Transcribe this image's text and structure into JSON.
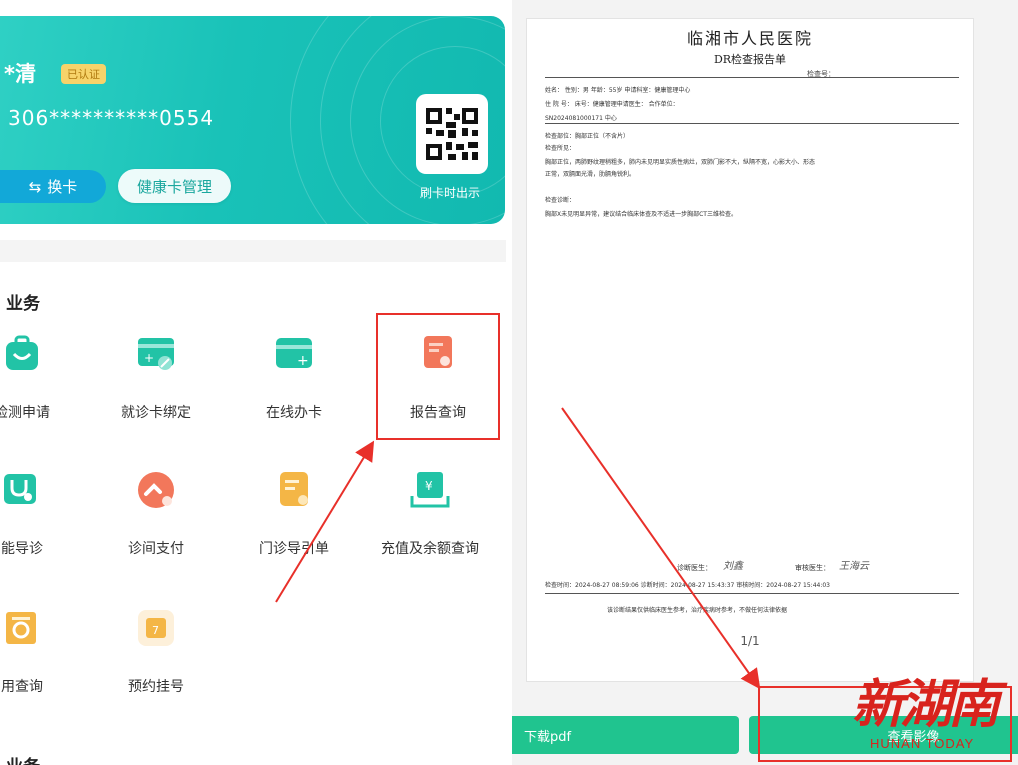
{
  "health_card": {
    "holder_name": "*清",
    "verified_badge": "已认证",
    "card_number": "306**********0554",
    "switch_card_label": "换卡",
    "switch_icon": "swap-arrows-icon",
    "manage_card_label": "健康卡管理",
    "qr_caption": "刷卡时出示",
    "qr_icon": "qr-code-icon"
  },
  "services": {
    "section_title": "业务",
    "section_title_2": "业务",
    "items": [
      {
        "label": "检测申请",
        "icon": "bag-icon",
        "color": "#22c3a6"
      },
      {
        "label": "就诊卡绑定",
        "icon": "card-link-icon",
        "color": "#22c3a6"
      },
      {
        "label": "在线办卡",
        "icon": "card-add-icon",
        "color": "#22c3a6"
      },
      {
        "label": "报告查询",
        "icon": "report-search-icon",
        "color": "#f2775b"
      },
      {
        "label": "能导诊",
        "icon": "stethoscope-icon",
        "color": "#22c3a6"
      },
      {
        "label": "诊间支付",
        "icon": "payment-icon",
        "color": "#f2775b"
      },
      {
        "label": "门诊导引单",
        "icon": "guide-sheet-icon",
        "color": "#f4b646"
      },
      {
        "label": "充值及余额查询",
        "icon": "yuan-card-icon",
        "color": "#22c3a6"
      },
      {
        "label": "用查询",
        "icon": "fee-search-icon",
        "color": "#f4b646"
      },
      {
        "label": "预约挂号",
        "icon": "calendar-icon",
        "color": "#f4b646"
      }
    ]
  },
  "report": {
    "hospital": "临湘市人民医院",
    "title": "DR检查报告单",
    "report_no_label": "检查号：",
    "lines": [
      "姓名：          性别：男      年龄：55岁        申请科室：健康管理中心",
      "住  院  号：           床号：健康管理申请医生：       合作单位：",
      "SN2024081000171         中心",
      "检查部位：胸部正位（不含片）",
      "检查所见：",
      "胸部正位，两肺野纹理稍粗多，肺内未见明显实质性病灶，双肺门影不大，纵隔不宽，心影大小、形态",
      "正常，双膈面光滑，肋膈角锐利。",
      "检查诊断：",
      "胸部X未见明显异常，建议结合临床体查及不适进一步胸部CT三维检查。"
    ],
    "signature_doctor_label": "诊断医生：",
    "signature_doctor": "刘鑫",
    "signature_reviewer_label": "审核医生：",
    "signature_reviewer": "王海云",
    "timestamps": "检查时间：2024-08-27 08:59:06   诊断时间：2024-08-27 15:43:37   审核时间：2024-08-27 15:44:03",
    "disclaimer": "该诊断结果仅供临床医生参考，治疗疾病时参考，不做任何法律依据",
    "page": "1/1"
  },
  "actions": {
    "download_pdf": "下载pdf",
    "view_images": "查看影像"
  },
  "watermark": {
    "cn": "新湖南",
    "en": "HUNAN TODAY"
  },
  "colors": {
    "card_gradient": "#19c2b8",
    "accent_green": "#20c48f",
    "highlight_red": "#e8302a"
  }
}
